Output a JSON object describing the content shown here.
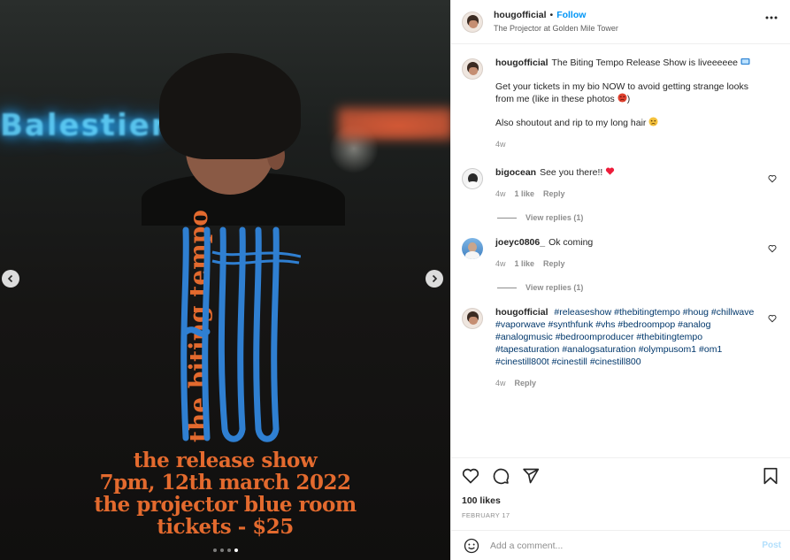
{
  "header": {
    "username": "hougofficial",
    "bullet": "•",
    "follow_label": "Follow",
    "location": "The Projector at Golden Mile Tower"
  },
  "photo": {
    "sign_text": "Balestier Ho",
    "poster_vertical": "the biting tempo",
    "poster_logo": "HOUG",
    "poster_lines": [
      "the release show",
      "7pm, 12th march 2022",
      "the projector blue room",
      "tickets - $25"
    ],
    "slide_count": 4,
    "active_slide": 4
  },
  "caption": {
    "username": "hougofficial",
    "line1": "The Biting Tempo Release Show is liveeeeee",
    "line2": "Get your tickets in my bio NOW to avoid getting strange looks from me (like in these photos",
    "line2_end": ")",
    "line3": "Also shoutout and rip to my long hair",
    "time": "4w"
  },
  "comments": [
    {
      "username": "bigocean",
      "text": "See you there!!",
      "time": "4w",
      "likes": "1 like",
      "reply": "Reply",
      "view_replies": "View replies (1)"
    },
    {
      "username": "joeyc0806_",
      "text": "Ok coming",
      "time": "4w",
      "likes": "1 like",
      "reply": "Reply",
      "view_replies": "View replies (1)"
    }
  ],
  "hashtag_comment": {
    "username": "hougofficial",
    "hashtags": [
      "#releaseshow",
      "#thebitingtempo",
      "#houg",
      "#chillwave",
      "#vaporwave",
      "#synthfunk",
      "#vhs",
      "#bedroompop",
      "#analog",
      "#analogmusic",
      "#bedroomproducer",
      "#thebitingtempo",
      "#tapesaturation",
      "#analogsaturation",
      "#olympusom1",
      "#om1",
      "#cinestill800t",
      "#cinestill",
      "#cinestill800"
    ],
    "time": "4w",
    "reply": "Reply"
  },
  "stats": {
    "likes": "100 likes",
    "date": "FEBRUARY 17"
  },
  "composer": {
    "placeholder": "Add a comment...",
    "post_label": "Post"
  },
  "colors": {
    "accent": "#0095f6",
    "hashtag": "#00376b",
    "poster_orange": "#e36a2e",
    "poster_blue": "#2f7fd1"
  },
  "icons": [
    "more-icon",
    "heart-icon",
    "comment-icon",
    "share-icon",
    "bookmark-icon",
    "emoji-icon",
    "chevron-left-icon",
    "chevron-right-icon"
  ]
}
